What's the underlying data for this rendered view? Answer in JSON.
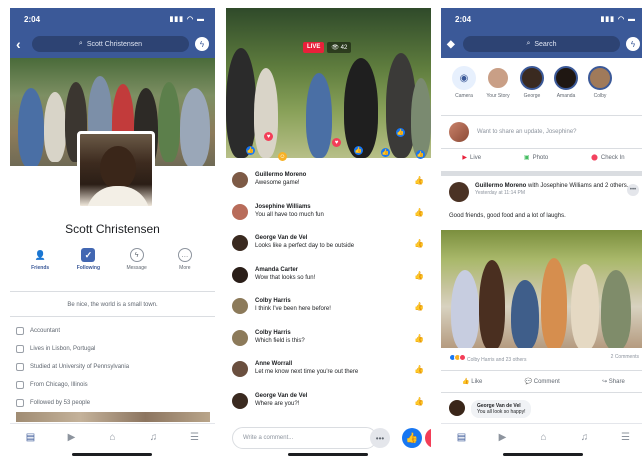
{
  "phone1": {
    "status_time": "2:04",
    "search_text": "Scott Christensen",
    "name": "Scott Christensen",
    "actions": [
      {
        "label": "Friends",
        "icon": "person-icon"
      },
      {
        "label": "Following",
        "icon": "rss-icon"
      },
      {
        "label": "Message",
        "icon": "messenger-icon"
      },
      {
        "label": "More",
        "icon": "more-icon"
      }
    ],
    "bio": "Be nice, the world is a small town.",
    "info": [
      "Accountant",
      "Lives in Lisbon, Portugal",
      "Studied at University of Pennsylvania",
      "From Chicago, Illinois",
      "Followed by 53 people"
    ]
  },
  "phone2": {
    "live_label": "LIVE",
    "viewer_count": "42",
    "comments": [
      {
        "name": "Guillermo Moreno",
        "text": "Awesome game!",
        "color": "#7d5a46"
      },
      {
        "name": "Josephine Williams",
        "text": "You all have too much fun",
        "color": "#b86c5a"
      },
      {
        "name": "George Van de Vel",
        "text": "Looks like a perfect day to be outside",
        "color": "#3a2a20"
      },
      {
        "name": "Amanda Carter",
        "text": "Wow that looks so fun!",
        "color": "#2a1e18"
      },
      {
        "name": "Colby Harris",
        "text": "I think I've been here before!",
        "color": "#8c7a5a"
      },
      {
        "name": "Colby Harris",
        "text": "Which field is this?",
        "color": "#8c7a5a"
      },
      {
        "name": "Anne Worrall",
        "text": "Let me know next time you're out there",
        "color": "#6a4f3f"
      },
      {
        "name": "George Van de Vel",
        "text": "Where are you?!",
        "color": "#3a2a20"
      }
    ],
    "compose_placeholder": "Write a comment..."
  },
  "phone3": {
    "status_time": "2:04",
    "search_placeholder": "Search",
    "stories": [
      {
        "label": "Camera",
        "color": "#e7f0fd"
      },
      {
        "label": "Your Story",
        "color": "#c99f86"
      },
      {
        "label": "George",
        "color": "#3a2a20"
      },
      {
        "label": "Amanda",
        "color": "#1f1712"
      },
      {
        "label": "Colby",
        "color": "#a07a5a"
      }
    ],
    "prompt": "Want to share an update, Josephine?",
    "quick_actions": [
      {
        "label": "Live",
        "color": "#e9203a"
      },
      {
        "label": "Photo",
        "color": "#45bd62"
      },
      {
        "label": "Check In",
        "color": "#f3425f"
      }
    ],
    "post": {
      "author": "Guillermo Moreno",
      "with_text": "with Josephine Williams and 2 others.",
      "time": "Yesterday at 11:14 PM",
      "text": "Good friends, good food and a lot of laughs.",
      "reactions_text": "Colby Harris and 23 others",
      "comments_count": "2 Comments",
      "actions": [
        "Like",
        "Comment",
        "Share"
      ]
    },
    "comment_preview": {
      "name": "George Van de Vel",
      "text": "You all look so happy!"
    }
  }
}
